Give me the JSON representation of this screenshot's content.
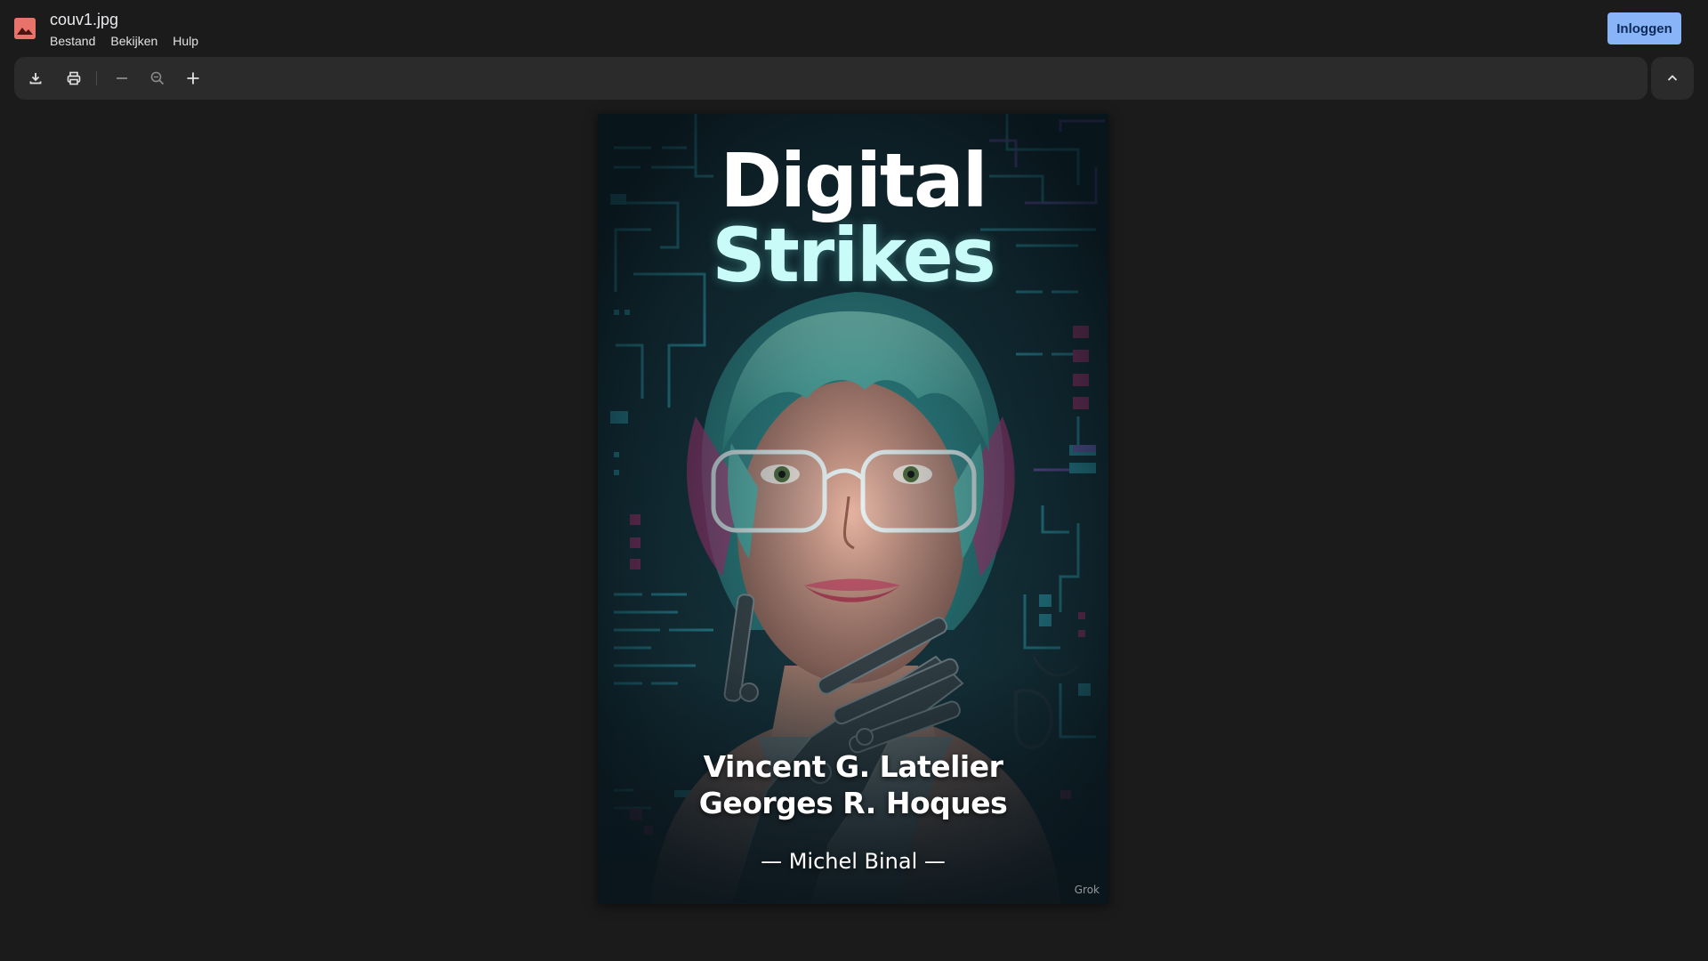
{
  "header": {
    "file_name": "couv1.jpg",
    "menu": [
      "Bestand",
      "Bekijken",
      "Hulp"
    ],
    "login_label": "Inloggen",
    "app_icon": "image-file-icon"
  },
  "toolbar": {
    "buttons": [
      "download-icon",
      "print-icon",
      "zoom-out-icon",
      "zoom-fit-icon",
      "zoom-in-icon"
    ],
    "collapse_icon": "chevron-up-icon"
  },
  "cover": {
    "title_line1": "Digital",
    "title_line2": "Strikes",
    "author1": "Vincent G. Latelier",
    "author2": "Georges R. Hoques",
    "illustrator": "— Michel Binal —",
    "watermark": "Grok"
  },
  "colors": {
    "background": "#1b1b1b",
    "toolbar": "#2b2b2b",
    "accent": "#8ab4f8",
    "app_icon": "#e8736a",
    "title_cyan": "#c9fbf8",
    "circuit_teal": "#2fb3c6",
    "circuit_magenta": "#c2307a"
  }
}
